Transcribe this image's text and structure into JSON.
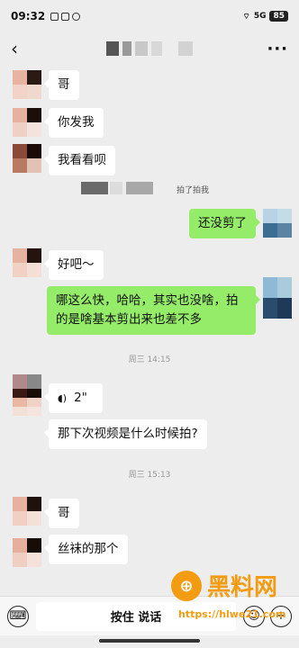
{
  "status_bar": {
    "time": "09:32",
    "battery": "85",
    "signal": "5G"
  },
  "nav": {
    "back_icon": "‹",
    "more_icon": "···"
  },
  "messages": [
    {
      "side": "left",
      "text": "哥"
    },
    {
      "side": "left",
      "text": "你发我"
    },
    {
      "side": "left",
      "text": "我看看呗"
    },
    {
      "side": "system",
      "text": "拍了拍我"
    },
    {
      "side": "right",
      "text": "还没剪了"
    },
    {
      "side": "left",
      "text": "好吧～"
    },
    {
      "side": "right",
      "text": "哪这么快，哈哈，其实也没啥，拍的是啥基本剪出来也差不多"
    },
    {
      "side": "time",
      "text": "周三 14:15"
    },
    {
      "side": "left_voice",
      "text": "2\""
    },
    {
      "side": "left",
      "text": "那下次视频是什么时候拍?"
    },
    {
      "side": "time",
      "text": "周三 15:13"
    },
    {
      "side": "left",
      "text": "哥"
    },
    {
      "side": "left",
      "text": "丝袜的那个"
    }
  ],
  "input_bar": {
    "hold_to_talk": "按住 说话",
    "keyboard_icon": "keyboard-icon",
    "emoji_icon": "emoji-icon",
    "plus_icon": "plus-icon"
  },
  "watermark": {
    "text": "黑料网",
    "url": "https://hlwe21.com"
  }
}
